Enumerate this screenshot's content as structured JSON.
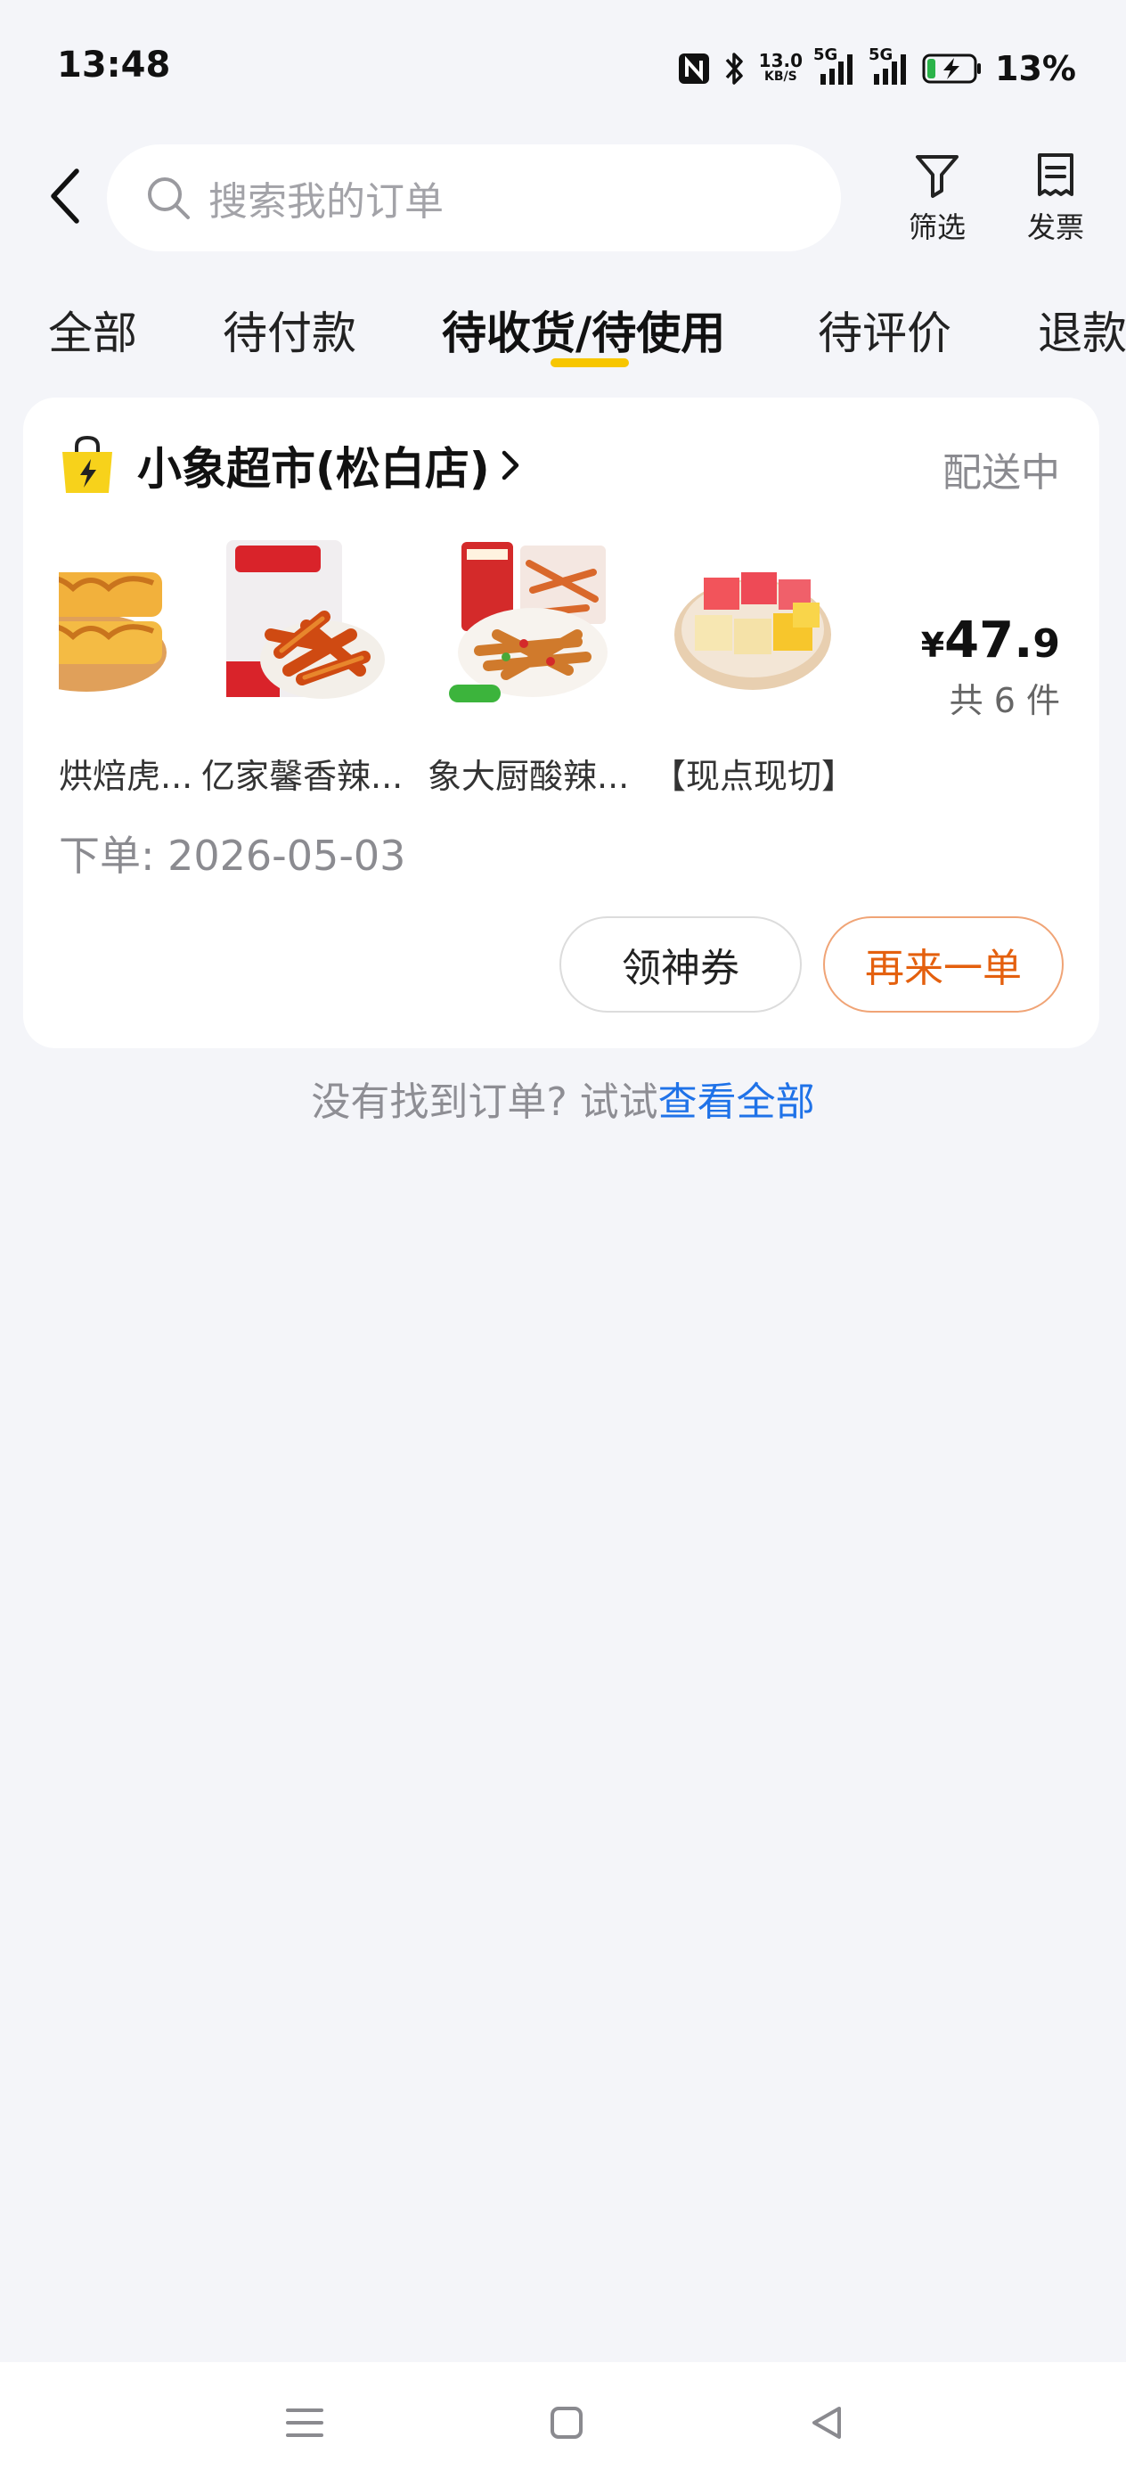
{
  "status_bar": {
    "time": "13:48",
    "net_speed_value": "13.0",
    "net_speed_unit": "KB/S",
    "signal1_label": "5G",
    "signal2_label": "5G",
    "battery": "13%",
    "icons": [
      "nfc-icon",
      "bluetooth-icon",
      "signal-icon",
      "battery-charging-icon"
    ]
  },
  "header": {
    "search_placeholder": "搜索我的订单",
    "filter_label": "筛选",
    "invoice_label": "发票"
  },
  "tabs": [
    {
      "label": "全部",
      "active": false
    },
    {
      "label": "待付款",
      "active": false
    },
    {
      "label": "待收货/待使用",
      "active": true
    },
    {
      "label": "待评价",
      "active": false
    },
    {
      "label": "退款",
      "active": false
    }
  ],
  "order": {
    "store_name": "小象超市(松白店)",
    "status": "配送中",
    "products": [
      {
        "name": "烘焙虎...",
        "icon": "baked-bread-thumb"
      },
      {
        "name": "亿家馨香辣...",
        "icon": "spicy-snack-thumb"
      },
      {
        "name": "象大厨酸辣...",
        "icon": "prepared-dish-thumb"
      },
      {
        "name": "【现点现切】...",
        "icon": "cut-fruit-thumb"
      }
    ],
    "price_symbol": "¥",
    "price_int": "47.",
    "price_dec": "9",
    "count": "共 6 件",
    "date": "下单: 2026-05-03",
    "coupon_button": "领神券",
    "reorder_button": "再来一单"
  },
  "not_found": {
    "text": "没有找到订单? 试试",
    "link": "查看全部"
  },
  "colors": {
    "accent_yellow": "#f7c600",
    "reorder_orange": "#e4600e",
    "link_blue": "#1f72e8",
    "background": "#f4f5f9"
  }
}
